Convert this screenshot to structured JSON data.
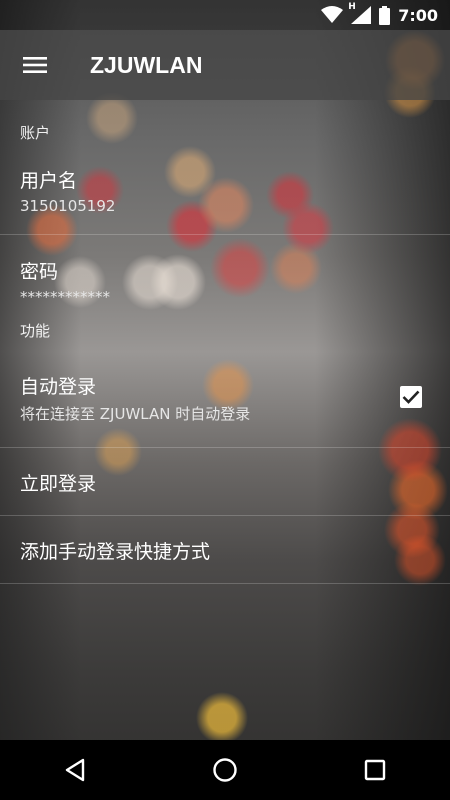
{
  "status_bar": {
    "time": "7:00",
    "network": "H",
    "icons": [
      "wifi-icon",
      "signal-icon",
      "battery-icon"
    ]
  },
  "toolbar": {
    "menu_icon": "hamburger-menu-icon",
    "title": "ZJUWLAN"
  },
  "sections": {
    "account": {
      "header": "账户",
      "username": {
        "title": "用户名",
        "summary": "3150105192"
      },
      "password": {
        "title": "密码",
        "summary": "************"
      }
    },
    "features": {
      "header": "功能",
      "auto_login": {
        "title": "自动登录",
        "summary": "将在连接至 ZJUWLAN 时自动登录",
        "checked": true
      },
      "login_now": {
        "title": "立即登录"
      },
      "shortcut": {
        "title": "添加手动登录快捷方式"
      }
    }
  },
  "nav_bar": {
    "icons": [
      "back-icon",
      "home-icon",
      "recents-icon"
    ]
  },
  "colors": {
    "toolbar": "#464646",
    "text": "#ffffff",
    "navbar": "#000000"
  }
}
